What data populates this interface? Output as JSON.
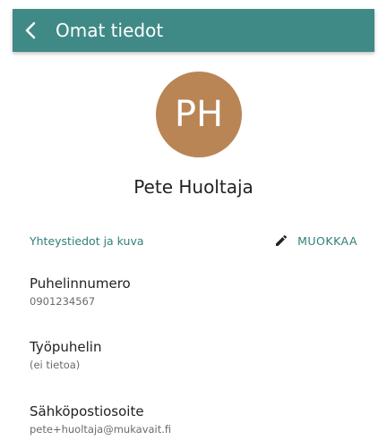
{
  "header": {
    "title": "Omat tiedot",
    "back_icon": "chevron-left-icon",
    "bar_color": "#3f8a86"
  },
  "profile": {
    "initials": "PH",
    "avatar_color": "#b98555",
    "full_name": "Pete Huoltaja"
  },
  "section": {
    "title": "Yhteystiedot ja kuva",
    "edit_label": "MUOKKAA",
    "edit_icon": "pencil-icon",
    "accent_color": "#2f7f7a"
  },
  "fields": [
    {
      "label": "Puhelinnumero",
      "value": "0901234567"
    },
    {
      "label": "Työpuhelin",
      "value": "(ei tietoa)"
    },
    {
      "label": "Sähköpostiosoite",
      "value": "pete+huoltaja@mukavait.fi"
    }
  ]
}
